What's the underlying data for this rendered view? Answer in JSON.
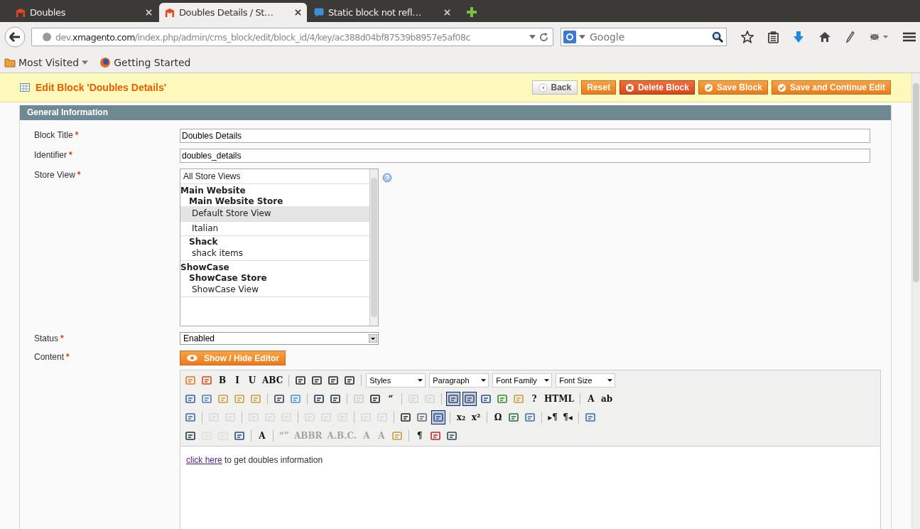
{
  "browser": {
    "tabs": [
      {
        "title": "Doubles",
        "selected": false
      },
      {
        "title": "Doubles Details / St…",
        "selected": true
      },
      {
        "title": "Static block not refl…",
        "selected": false
      }
    ],
    "url": "dev.**xmagento.com**/index.php/admin/cms_block/edit/block_id/4/key/ac388d04bf87539b8957e5af08c",
    "search": {
      "placeholder": "Google"
    },
    "bookmarks": [
      {
        "label": "Most Visited",
        "kind": "folder"
      },
      {
        "label": "Getting Started",
        "kind": "page"
      }
    ]
  },
  "page_header": {
    "title": "Edit Block 'Doubles Details'",
    "buttons": [
      {
        "label": "Back",
        "kind": "back"
      },
      {
        "label": "Reset",
        "kind": "plain"
      },
      {
        "label": "Delete Block",
        "kind": "delete"
      },
      {
        "label": "Save Block",
        "kind": "save"
      },
      {
        "label": "Save and Continue Edit",
        "kind": "save"
      }
    ]
  },
  "section": {
    "title": "General Information"
  },
  "form": {
    "block_title": {
      "label": "Block Title",
      "required_mark": "*",
      "value": "Doubles Details"
    },
    "identifier": {
      "label": "Identifier",
      "required_mark": "*",
      "value": "doubles_details"
    },
    "store_view": {
      "label": "Store View",
      "required_mark": "*",
      "options": [
        {
          "label": "All Store Views",
          "kind": "all",
          "selected": false
        },
        {
          "label": "Main Website",
          "kind": "website",
          "selected": false
        },
        {
          "label": "Main Website Store",
          "kind": "store",
          "selected": false
        },
        {
          "label": "Default Store View",
          "kind": "view",
          "selected": true
        },
        {
          "label": "Italian",
          "kind": "view",
          "selected": false
        },
        {
          "label": "Shack",
          "kind": "store",
          "selected": false
        },
        {
          "label": "shack items",
          "kind": "view",
          "selected": false
        },
        {
          "label": "ShowCase",
          "kind": "website",
          "selected": false
        },
        {
          "label": "ShowCase Store",
          "kind": "store",
          "selected": false
        },
        {
          "label": "ShowCase View",
          "kind": "view",
          "selected": false
        }
      ]
    },
    "status": {
      "label": "Status",
      "required_mark": "*",
      "value": "Enabled"
    },
    "content": {
      "label": "Content",
      "required_mark": "*",
      "toggle_button": "Show / Hide Editor",
      "toolbar": [
        [
          {
            "kind": "icon",
            "disabled": false,
            "selected": false
          },
          {
            "kind": "icon",
            "disabled": false,
            "selected": false
          },
          {
            "kind": "glyph",
            "label": "B",
            "disabled": false,
            "selected": false
          },
          {
            "kind": "glyph",
            "label": "I",
            "disabled": false,
            "selected": false
          },
          {
            "kind": "glyph",
            "label": "U",
            "disabled": false,
            "selected": false
          },
          {
            "kind": "glyph",
            "label": "ABC",
            "disabled": false,
            "selected": false
          },
          {
            "kind": "separator"
          },
          {
            "kind": "icon",
            "disabled": false,
            "selected": false
          },
          {
            "kind": "icon",
            "disabled": false,
            "selected": false
          },
          {
            "kind": "icon",
            "disabled": false,
            "selected": false
          },
          {
            "kind": "icon",
            "disabled": false,
            "selected": false
          },
          {
            "kind": "separator"
          },
          {
            "kind": "select",
            "label": "Styles"
          },
          {
            "kind": "select",
            "label": "Paragraph"
          },
          {
            "kind": "select",
            "label": "Font Family"
          },
          {
            "kind": "select",
            "label": "Font Size"
          }
        ],
        [
          {
            "kind": "icon",
            "disabled": false,
            "selected": false
          },
          {
            "kind": "icon",
            "disabled": false,
            "selected": false
          },
          {
            "kind": "icon",
            "disabled": false,
            "selected": false
          },
          {
            "kind": "icon",
            "disabled": false,
            "selected": false
          },
          {
            "kind": "icon",
            "disabled": false,
            "selected": false
          },
          {
            "kind": "separator"
          },
          {
            "kind": "icon",
            "disabled": false,
            "selected": false
          },
          {
            "kind": "icon",
            "disabled": false,
            "selected": false
          },
          {
            "kind": "separator"
          },
          {
            "kind": "icon",
            "disabled": false,
            "selected": false
          },
          {
            "kind": "icon",
            "disabled": false,
            "selected": false
          },
          {
            "kind": "separator"
          },
          {
            "kind": "icon",
            "disabled": true,
            "selected": false
          },
          {
            "kind": "icon",
            "disabled": false,
            "selected": false
          },
          {
            "kind": "glyph",
            "label": "“",
            "disabled": false,
            "selected": false
          },
          {
            "kind": "separator"
          },
          {
            "kind": "icon",
            "disabled": true,
            "selected": false
          },
          {
            "kind": "icon",
            "disabled": true,
            "selected": false
          },
          {
            "kind": "separator"
          },
          {
            "kind": "icon",
            "disabled": false,
            "selected": true
          },
          {
            "kind": "icon",
            "disabled": false,
            "selected": true
          },
          {
            "kind": "icon",
            "disabled": false,
            "selected": false
          },
          {
            "kind": "icon",
            "disabled": false,
            "selected": false
          },
          {
            "kind": "icon",
            "disabled": false,
            "selected": false
          },
          {
            "kind": "glyph",
            "label": "?",
            "disabled": false,
            "selected": false
          },
          {
            "kind": "glyph",
            "label": "HTML",
            "disabled": false,
            "selected": false
          },
          {
            "kind": "separator"
          },
          {
            "kind": "glyph",
            "label": "A",
            "disabled": false,
            "selected": false
          },
          {
            "kind": "glyph",
            "label": "ab",
            "disabled": false,
            "selected": false
          }
        ],
        [
          {
            "kind": "icon",
            "disabled": false,
            "selected": false
          },
          {
            "kind": "separator"
          },
          {
            "kind": "icon",
            "disabled": true,
            "selected": false
          },
          {
            "kind": "icon",
            "disabled": true,
            "selected": false
          },
          {
            "kind": "separator"
          },
          {
            "kind": "icon",
            "disabled": true,
            "selected": false
          },
          {
            "kind": "icon",
            "disabled": true,
            "selected": false
          },
          {
            "kind": "icon",
            "disabled": true,
            "selected": false
          },
          {
            "kind": "separator"
          },
          {
            "kind": "icon",
            "disabled": true,
            "selected": false
          },
          {
            "kind": "icon",
            "disabled": true,
            "selected": false
          },
          {
            "kind": "icon",
            "disabled": true,
            "selected": false
          },
          {
            "kind": "separator"
          },
          {
            "kind": "icon",
            "disabled": true,
            "selected": false
          },
          {
            "kind": "icon",
            "disabled": true,
            "selected": false
          },
          {
            "kind": "separator"
          },
          {
            "kind": "icon",
            "disabled": false,
            "selected": false
          },
          {
            "kind": "icon",
            "disabled": false,
            "selected": false
          },
          {
            "kind": "icon",
            "disabled": false,
            "selected": true
          },
          {
            "kind": "separator"
          },
          {
            "kind": "glyph",
            "label": "x₂",
            "disabled": false,
            "selected": false
          },
          {
            "kind": "glyph",
            "label": "x²",
            "disabled": false,
            "selected": false
          },
          {
            "kind": "separator"
          },
          {
            "kind": "glyph",
            "label": "Ω",
            "disabled": false,
            "selected": false
          },
          {
            "kind": "icon",
            "disabled": false,
            "selected": false
          },
          {
            "kind": "icon",
            "disabled": false,
            "selected": false
          },
          {
            "kind": "separator"
          },
          {
            "kind": "glyph",
            "label": "▸¶",
            "disabled": false,
            "selected": false
          },
          {
            "kind": "glyph",
            "label": "¶◂",
            "disabled": false,
            "selected": false
          },
          {
            "kind": "separator"
          },
          {
            "kind": "icon",
            "disabled": false,
            "selected": false
          }
        ],
        [
          {
            "kind": "icon",
            "disabled": false,
            "selected": false
          },
          {
            "kind": "icon",
            "disabled": true,
            "selected": false
          },
          {
            "kind": "icon",
            "disabled": true,
            "selected": false
          },
          {
            "kind": "icon",
            "disabled": false,
            "selected": false
          },
          {
            "kind": "separator"
          },
          {
            "kind": "glyph",
            "label": "A",
            "disabled": false,
            "selected": false
          },
          {
            "kind": "separator"
          },
          {
            "kind": "glyph",
            "label": "“”",
            "disabled": true,
            "selected": false
          },
          {
            "kind": "glyph",
            "label": "ABBR",
            "disabled": true,
            "selected": false
          },
          {
            "kind": "glyph",
            "label": "A.B.C.",
            "disabled": true,
            "selected": false
          },
          {
            "kind": "glyph",
            "label": "A",
            "disabled": true,
            "selected": false
          },
          {
            "kind": "glyph",
            "label": "A",
            "disabled": true,
            "selected": false
          },
          {
            "kind": "icon",
            "disabled": false,
            "selected": false
          },
          {
            "kind": "separator"
          },
          {
            "kind": "glyph",
            "label": "¶",
            "disabled": false,
            "selected": false
          },
          {
            "kind": "icon",
            "disabled": false,
            "selected": false
          },
          {
            "kind": "icon",
            "disabled": false,
            "selected": false
          }
        ]
      ],
      "body": {
        "link": "click here",
        "text": "to get doubles information"
      }
    }
  }
}
